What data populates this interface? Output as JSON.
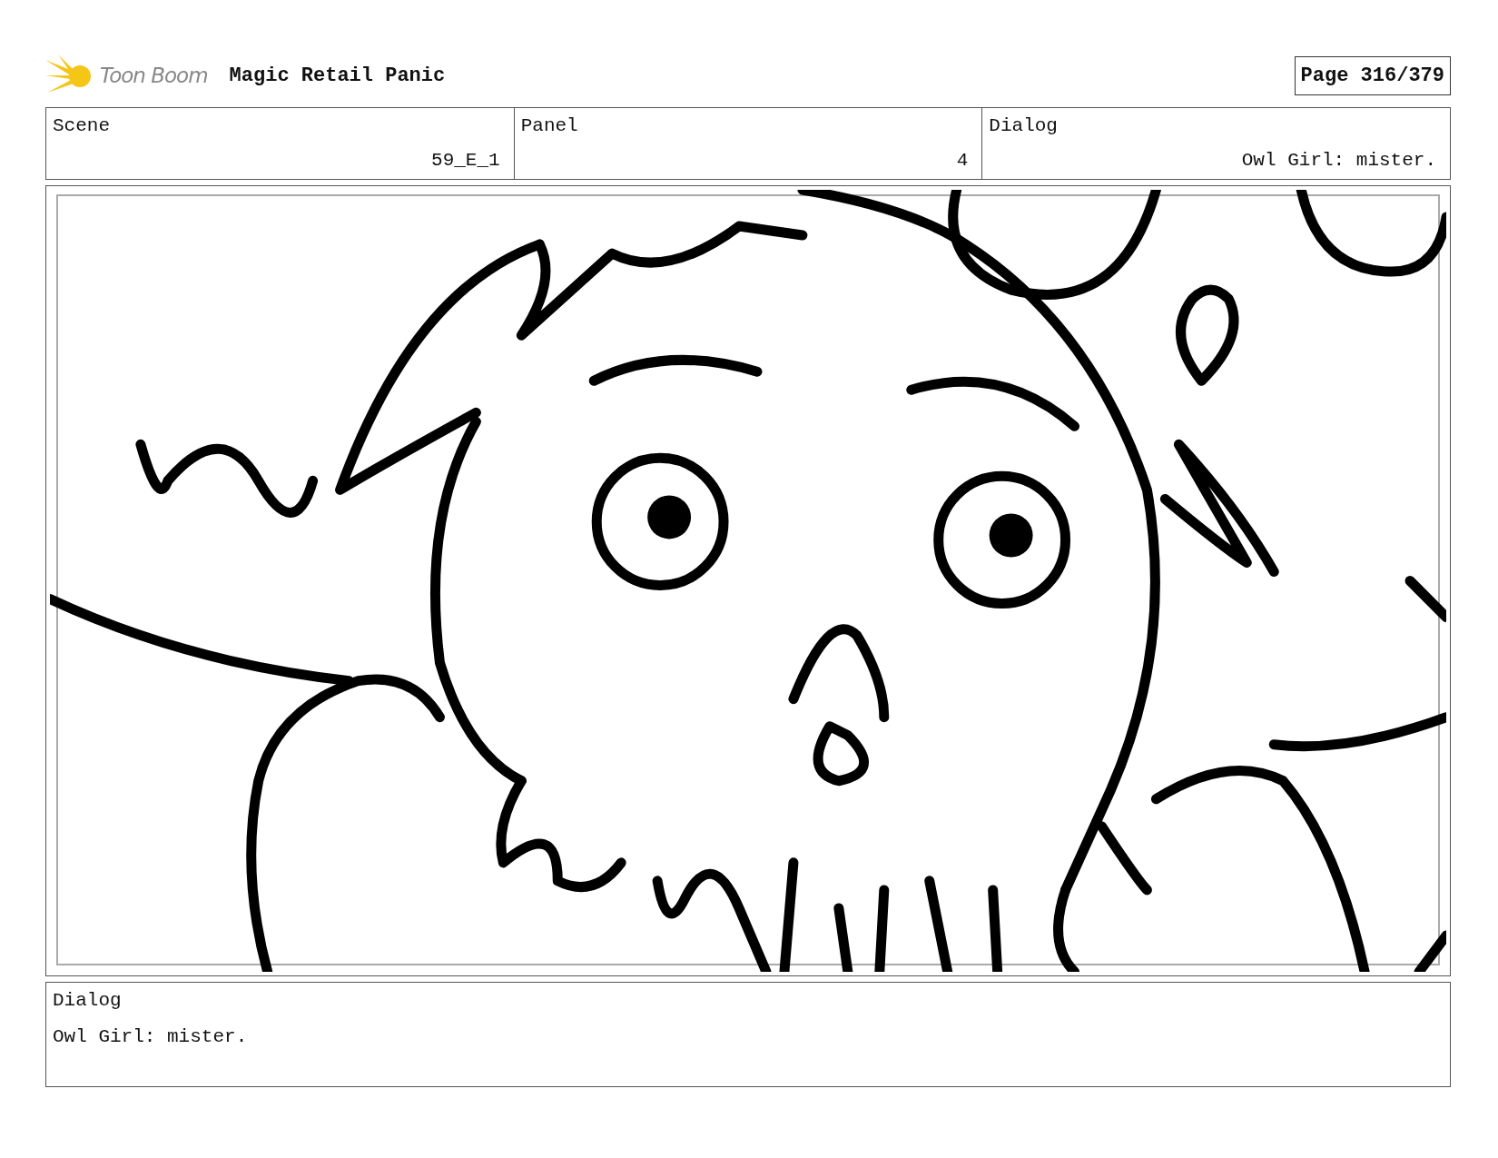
{
  "header": {
    "logo_text": "Toon Boom",
    "project_title": "Magic Retail Panic",
    "page": "Page 316/379"
  },
  "info": [
    {
      "label": "Scene",
      "value": "59_E_1"
    },
    {
      "label": "Panel",
      "value": "4"
    },
    {
      "label": "Dialog",
      "value": "Owl Girl: mister."
    }
  ],
  "dialog": {
    "label": "Dialog",
    "text": "Owl Girl: mister."
  }
}
